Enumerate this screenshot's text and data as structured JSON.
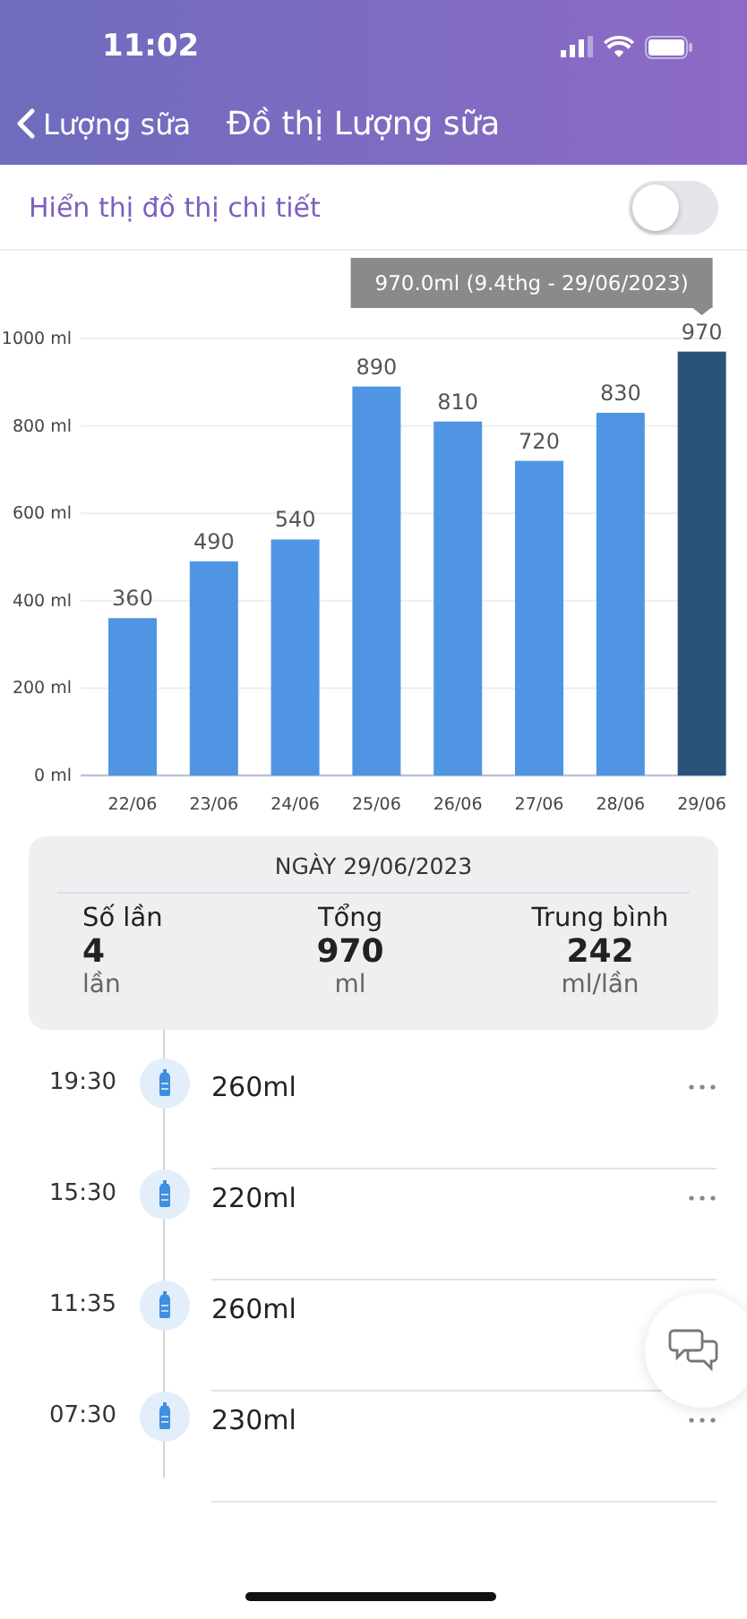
{
  "status_bar": {
    "time": "11:02"
  },
  "nav": {
    "back_label": "Lượng sữa",
    "title": "Đồ thị Lượng sữa"
  },
  "detail_toggle": {
    "label": "Hiển thị đồ thị chi tiết",
    "on": false
  },
  "chart": {
    "chart_data": {
      "type": "bar",
      "categories": [
        "22/06",
        "23/06",
        "24/06",
        "25/06",
        "26/06",
        "27/06",
        "28/06",
        "29/06"
      ],
      "values": [
        360,
        490,
        540,
        890,
        810,
        720,
        830,
        970
      ],
      "ylim": [
        0,
        1000
      ],
      "yticks": [
        {
          "value": 0,
          "label": "0 ml"
        },
        {
          "value": 200,
          "label": "200 ml"
        },
        {
          "value": 400,
          "label": "400 ml"
        },
        {
          "value": 600,
          "label": "600 ml"
        },
        {
          "value": 800,
          "label": "800 ml"
        },
        {
          "value": 1000,
          "label": "1000 ml"
        }
      ],
      "data_labels": true,
      "grid": true,
      "annotations": [
        "970.0ml (9.4thg - 29/06/2023)"
      ]
    },
    "bars": [
      {
        "selected": false
      },
      {
        "selected": false
      },
      {
        "selected": false
      },
      {
        "selected": false
      },
      {
        "selected": false
      },
      {
        "selected": false
      },
      {
        "selected": false
      },
      {
        "selected": true
      }
    ]
  },
  "summary": {
    "date": "NGÀY 29/06/2023",
    "stats": [
      {
        "label": "Số lần",
        "value": "4",
        "unit": "lần"
      },
      {
        "label": "Tổng",
        "value": "970",
        "unit": "ml"
      },
      {
        "label": "Trung bình",
        "value": "242",
        "unit": "ml/lần"
      }
    ]
  },
  "feedings": [
    {
      "time": "19:30",
      "amount": "260ml"
    },
    {
      "time": "15:30",
      "amount": "220ml"
    },
    {
      "time": "11:35",
      "amount": "260ml"
    },
    {
      "time": "07:30",
      "amount": "230ml"
    }
  ]
}
